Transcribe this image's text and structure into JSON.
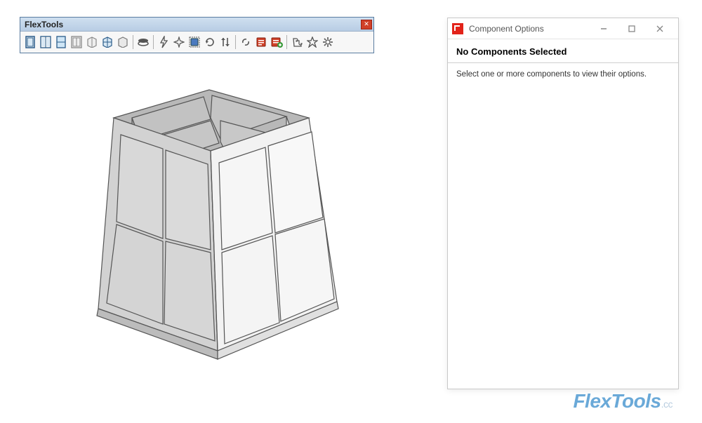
{
  "toolbar": {
    "title": "FlexTools",
    "icons": [
      {
        "name": "door-single-icon"
      },
      {
        "name": "door-double-icon"
      },
      {
        "name": "door-glazed-icon"
      },
      {
        "name": "door-sliding-icon"
      },
      {
        "name": "window-single-icon"
      },
      {
        "name": "window-double-icon"
      },
      {
        "name": "window-glazed-icon"
      },
      {
        "sep": true
      },
      {
        "name": "pancake-icon"
      },
      {
        "sep": true
      },
      {
        "name": "zap-icon"
      },
      {
        "name": "sparkle-icon"
      },
      {
        "name": "component-finder-icon"
      },
      {
        "name": "reload-icon"
      },
      {
        "name": "flip-icon"
      },
      {
        "sep": true
      },
      {
        "name": "unlink-icon"
      },
      {
        "name": "report-icon"
      },
      {
        "name": "report-add-icon"
      },
      {
        "sep": true
      },
      {
        "name": "puzzle-icon"
      },
      {
        "name": "star-icon"
      },
      {
        "name": "gear-icon"
      }
    ]
  },
  "component_panel": {
    "window_title": "Component Options",
    "header": "No Components Selected",
    "body_text": "Select one or more components to view their options."
  },
  "watermark": {
    "brand": "FlexTools",
    "suffix": ".cc"
  }
}
